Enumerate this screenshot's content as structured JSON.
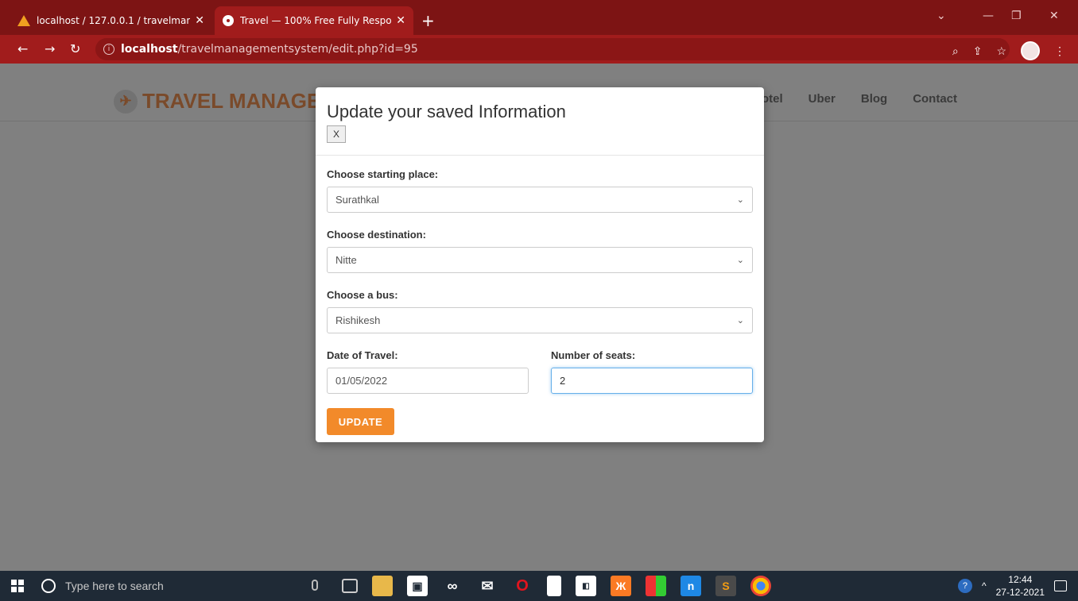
{
  "browser": {
    "tabs": [
      {
        "title": "localhost / 127.0.0.1 / travelmana",
        "close": "✕"
      },
      {
        "title": "Travel — 100% Free Fully Respon",
        "close": "✕"
      }
    ],
    "new_tab": "+",
    "url_host": "localhost",
    "url_path": "/travelmanagementsystem/edit.php?id=95"
  },
  "site": {
    "brand": "TRAVEL MANAGE",
    "nav": [
      "otel",
      "Uber",
      "Blog",
      "Contact"
    ]
  },
  "modal": {
    "title": "Update your saved Information",
    "close_label": "X",
    "start_label": "Choose starting place:",
    "start_value": "Surathkal",
    "dest_label": "Choose destination:",
    "dest_value": "Nitte",
    "bus_label": "Choose a bus:",
    "bus_value": "Rishikesh",
    "date_label": "Date of Travel:",
    "date_value": "01/05/2022",
    "seats_label": "Number of seats:",
    "seats_value": "2",
    "update_label": "UPDATE"
  },
  "taskbar": {
    "search_placeholder": "Type here to search",
    "time": "12:44",
    "date": "27-12-2021"
  },
  "colors": {
    "chrome_dark": "#7d1414",
    "chrome": "#a11c1c",
    "update_button": "#f28a2a",
    "overlay": "#808080"
  }
}
